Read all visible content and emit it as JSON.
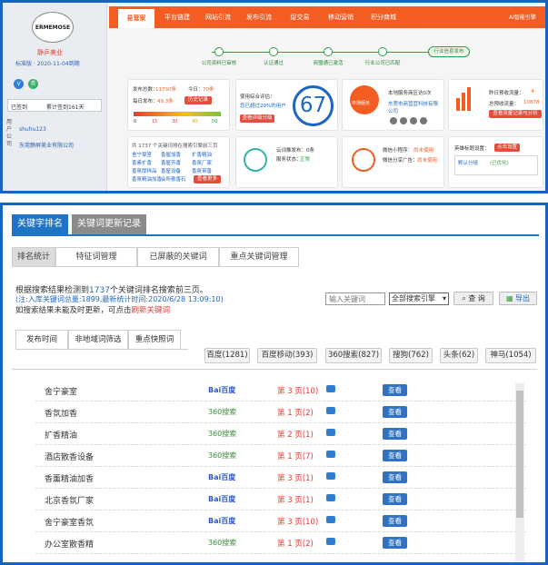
{
  "top": {
    "logo_text": "ERMEMOSE",
    "company": "静乒美业",
    "version_line": "标准版 · 2020-11-04到期",
    "badges": [
      "V",
      "盾"
    ],
    "sign_status": "已签到",
    "sign_days": "累计签到161天",
    "user_label": "用户公司",
    "username": "shuhu123",
    "user_company": "东莞静屏美业有限公司",
    "nav": [
      "易营家",
      "平台链建",
      "网站引流",
      "发布引流",
      "促交易",
      "移动营销",
      "积分商城"
    ],
    "ai_link": "AI智能引擎",
    "steps": [
      "公司资料已审核",
      "认证通过",
      "商盟通已激活",
      "行业公司已匹配",
      "行业信息发布"
    ],
    "stats": {
      "publish_total_label": "发布总数：",
      "publish_total": "11730条",
      "today_label": "今日：",
      "today": "70条",
      "daily_label": "每日发布：",
      "daily": "49.3条",
      "history_btn": "历史记录",
      "scale": [
        "0",
        "15",
        "30",
        "40",
        "50"
      ]
    },
    "score": {
      "label": "使用综合评估：",
      "text": "您已超过29%的用户",
      "value": "67",
      "btn": "查看评级分级"
    },
    "service": {
      "badge": "市场服务",
      "line1": "本地服务商区访0次",
      "company": "东莞市商营营科技有限公司"
    },
    "traffic": {
      "yesterday_label": "昨日预收流量：",
      "yesterday": "4",
      "total_label": "总预收流量：",
      "total": "10878",
      "btn": "查看流量记录与分析"
    },
    "keywords": {
      "intro": "共 1737 个关键词排在搜索引擎前三页",
      "words": [
        [
          "舍宁豪室",
          "香屋加香",
          "扩香精油"
        ],
        [
          "香素扩香",
          "香屋芳香",
          "香氛厂家"
        ],
        [
          "香氛厚样品",
          "香屋设备",
          "香氛带香"
        ],
        [
          "香氛精油加香",
          "会所散香石",
          ""
        ]
      ],
      "btn": "查看更多"
    },
    "cloud": {
      "line1": "云词推发布：0条",
      "line2": "服务状态：",
      "status": "正常"
    },
    "wechat": {
      "line1": "微信小程序：",
      "v1": "尚未使用",
      "line2": "微信分享广告：",
      "v2": "尚未使用"
    },
    "hero": {
      "label": "英雄标题设置：",
      "btn": "点击设置",
      "label2": "默认分组",
      "value2": "(已优化)"
    }
  },
  "bottom": {
    "tabs": [
      "关键字排名",
      "关键词更新记录"
    ],
    "subtabs": [
      "排名统计",
      "特征词管理",
      "已屏蔽的关键词",
      "重点关键词管理"
    ],
    "info_prefix": "根据搜索结果检测到",
    "info_count": "1737",
    "info_suffix": "个关键词排名搜索前三页。",
    "note": "(注:入库关键词总量:1899,最新统计时间:2020/6/28 13:09:10)",
    "note2_prefix": "如搜索结果未能及时更新，可点击",
    "note2_link": "刷新关键词",
    "search_placeholder": "输入关键词",
    "engine_select": "全部搜索引擎",
    "query_btn": "查 询",
    "export_btn": "导出",
    "filters": [
      "发布时间",
      "非地域词筛选",
      "重点快照词"
    ],
    "engines": [
      "百度(1281)",
      "百度移动(393)",
      "360搜索(827)",
      "搜狗(762)",
      "头条(62)",
      "神马(1054)"
    ],
    "view_label": "查看",
    "rows": [
      {
        "kw": "舍宁豪室",
        "engine": "baidu",
        "eng_text": "Bai百度",
        "rank": "第 3 页(10)"
      },
      {
        "kw": "香氛加香",
        "engine": "360",
        "eng_text": "360搜索",
        "rank": "第 1 页(2)"
      },
      {
        "kw": "扩香精油",
        "engine": "360",
        "eng_text": "360搜索",
        "rank": "第 2 页(1)"
      },
      {
        "kw": "酒店散香设备",
        "engine": "360",
        "eng_text": "360搜索",
        "rank": "第 1 页(7)"
      },
      {
        "kw": "香薰精油加香",
        "engine": "baidu",
        "eng_text": "Bai百度",
        "rank": "第 3 页(1)"
      },
      {
        "kw": "北京香氛厂家",
        "engine": "baidu",
        "eng_text": "Bai百度",
        "rank": "第 3 页(1)"
      },
      {
        "kw": "舍宁豪室香氛",
        "engine": "baidu",
        "eng_text": "Bai百度",
        "rank": "第 3 页(10)"
      },
      {
        "kw": "办公室散香精",
        "engine": "360",
        "eng_text": "360搜索",
        "rank": "第 1 页(2)"
      }
    ],
    "colors": {
      "accent": "#f45d22",
      "blue": "#1565c0",
      "red": "#e53935"
    }
  }
}
